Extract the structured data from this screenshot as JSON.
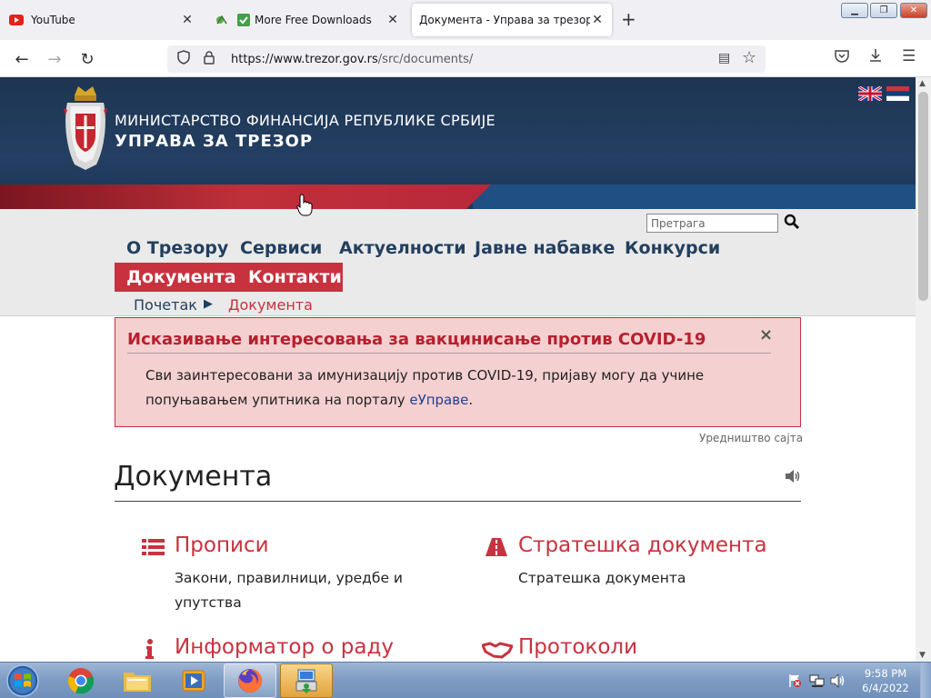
{
  "browser": {
    "tabs": [
      {
        "title": "YouTube",
        "favicon": "youtube-icon"
      },
      {
        "title": "More Free Downloads",
        "favicon": "check-icon"
      },
      {
        "title": "Документа - Управа за трезор",
        "favicon": "none",
        "active": true
      }
    ],
    "new_tab_label": "+",
    "url_host": "https://www.trezor.gov.rs",
    "url_path": "/src/documents/"
  },
  "site": {
    "ministry_line": "МИНИСТАРСТВО ФИНАНСИЈА РЕПУБЛИКЕ СРБИЈЕ",
    "org_name": "УПРАВА ЗА ТРЕЗОР",
    "search_placeholder": "Претрага",
    "menu": {
      "o_trezoru": "О Трезору",
      "servisi": "Сервиси",
      "aktuelnosti": "Актуелности",
      "nabavke": "Јавне набавке",
      "konkursi": "Конкурси",
      "dokumenta": "Документа",
      "kontakti": "Контакти"
    },
    "breadcrumb": {
      "home": "Почетак",
      "separator": "▶",
      "current": "Документа"
    }
  },
  "alert": {
    "title": "Исказивање интересовања за вакцинисање против COVID-19",
    "body_before": "Сви заинтересовани за имунизацију против COVID-19, пријаву могу да учине попуњавањем упитника на порталу ",
    "link": "еУправе",
    "body_after": ".",
    "close": "×"
  },
  "content": {
    "editorial": "Уредништво сајта",
    "title": "Документа",
    "categories": [
      {
        "title": "Прописи",
        "desc": "Закони, правилници, уредбе и упутства",
        "icon": "list-icon"
      },
      {
        "title": "Стратешка документа",
        "desc": "Стратешка документа",
        "icon": "road-icon"
      },
      {
        "title": "Информатор о раду",
        "desc": "",
        "icon": "info-icon"
      },
      {
        "title": "Протоколи",
        "desc": "",
        "icon": "handshake-icon"
      }
    ]
  },
  "taskbar": {
    "time": "9:58 PM",
    "date": "6/4/2022"
  },
  "colors": {
    "brand_blue": "#233f5e",
    "brand_red": "#c8323e",
    "alert_bg": "#f4d0d0"
  }
}
